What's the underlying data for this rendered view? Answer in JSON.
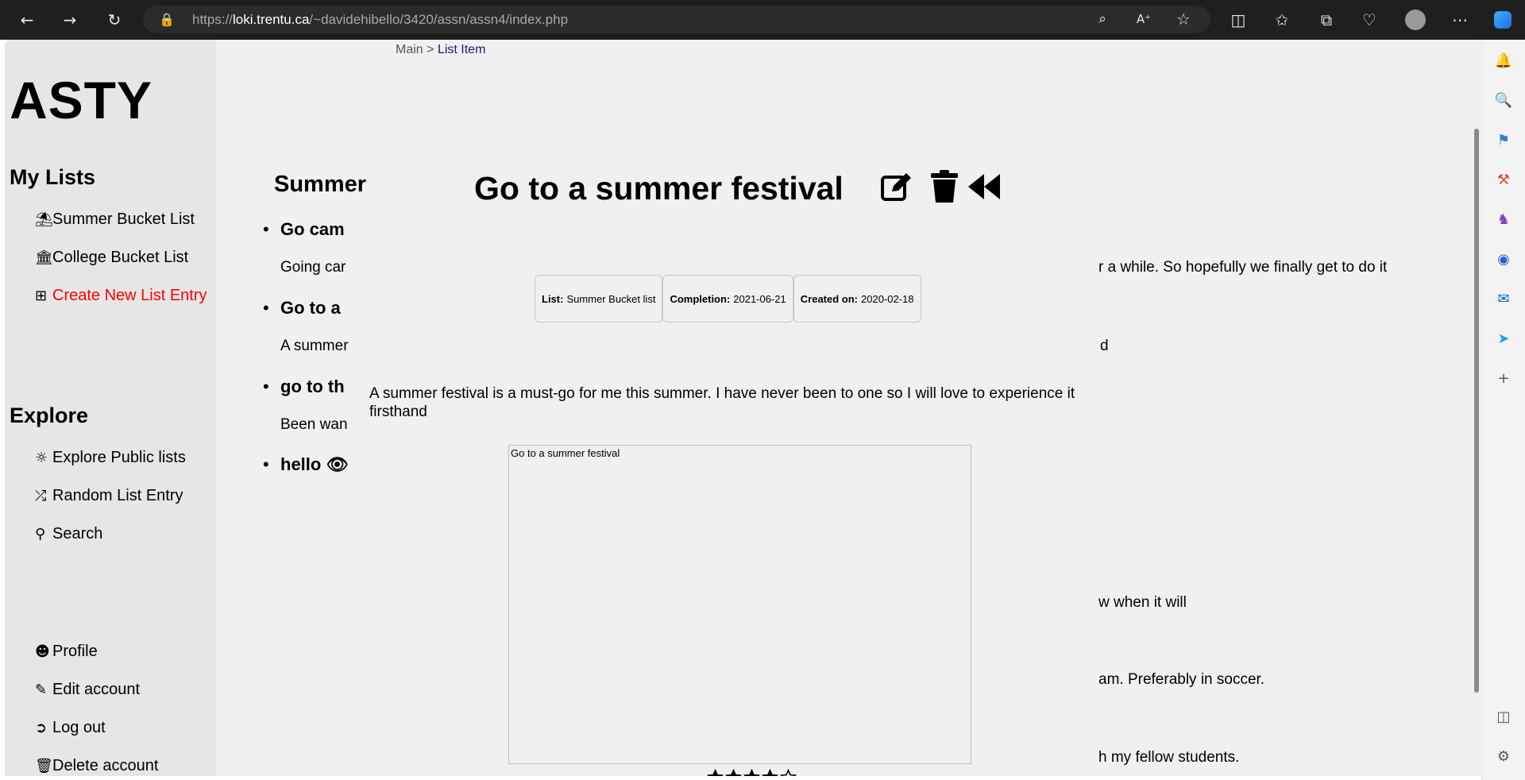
{
  "browser": {
    "url_prefix": "https://",
    "url_host": "loki.trentu.ca",
    "url_path": "/~davidehibello/3420/assn/assn4/index.php"
  },
  "site": {
    "logo": "ASTY"
  },
  "breadcrumb": {
    "root": "Main",
    "separator": ">",
    "current": "List Item"
  },
  "nav": {
    "my_lists_heading": "My Lists",
    "my_lists": [
      {
        "icon": "umbrella-beach-icon",
        "label": "Summer Bucket List"
      },
      {
        "icon": "building-columns-icon",
        "label": "College Bucket List"
      },
      {
        "icon": "square-plus-icon",
        "label": "Create New List Entry"
      }
    ],
    "explore_heading": "Explore",
    "explore": [
      {
        "icon": "compass-icon",
        "label": "Explore Public lists"
      },
      {
        "icon": "shuffle-icon",
        "label": "Random List Entry"
      },
      {
        "icon": "search-icon",
        "label": "Search"
      }
    ],
    "account": [
      {
        "icon": "user-icon",
        "label": "Profile"
      },
      {
        "icon": "pen-to-square-icon",
        "label": "Edit account"
      },
      {
        "icon": "log-out-icon",
        "label": "Log out"
      },
      {
        "icon": "trash-icon",
        "label": "Delete account"
      }
    ]
  },
  "background_list": {
    "title": "Summer",
    "items": [
      {
        "title": "Go cam",
        "desc": "Going car"
      },
      {
        "title": "Go to a",
        "desc": "A summer"
      },
      {
        "title": "go to th",
        "desc": "Been wan"
      },
      {
        "title": "hello",
        "desc": ""
      }
    ],
    "right_fragments": [
      "r a while. So hopefully we finally get to do it",
      "d",
      "w when it will",
      "am. Preferably in soccer.",
      "h my fellow students."
    ]
  },
  "item": {
    "title": "Go to a summer festival",
    "list_label": "List:",
    "list_value": "Summer Bucket list",
    "completion_label": "Completion:",
    "completion_value": "2021-06-21",
    "created_label": "Created on:",
    "created_value": "2020-02-18",
    "description": "A summer festival is a must-go for me this summer. I have never been to one so I will love to experience it firsthand",
    "image_alt": "Go to a summer festival",
    "rating": 4,
    "rating_max": 5
  },
  "colors": {
    "create_link": "#ff0000",
    "breadcrumb_link": "#1a1a8a"
  }
}
